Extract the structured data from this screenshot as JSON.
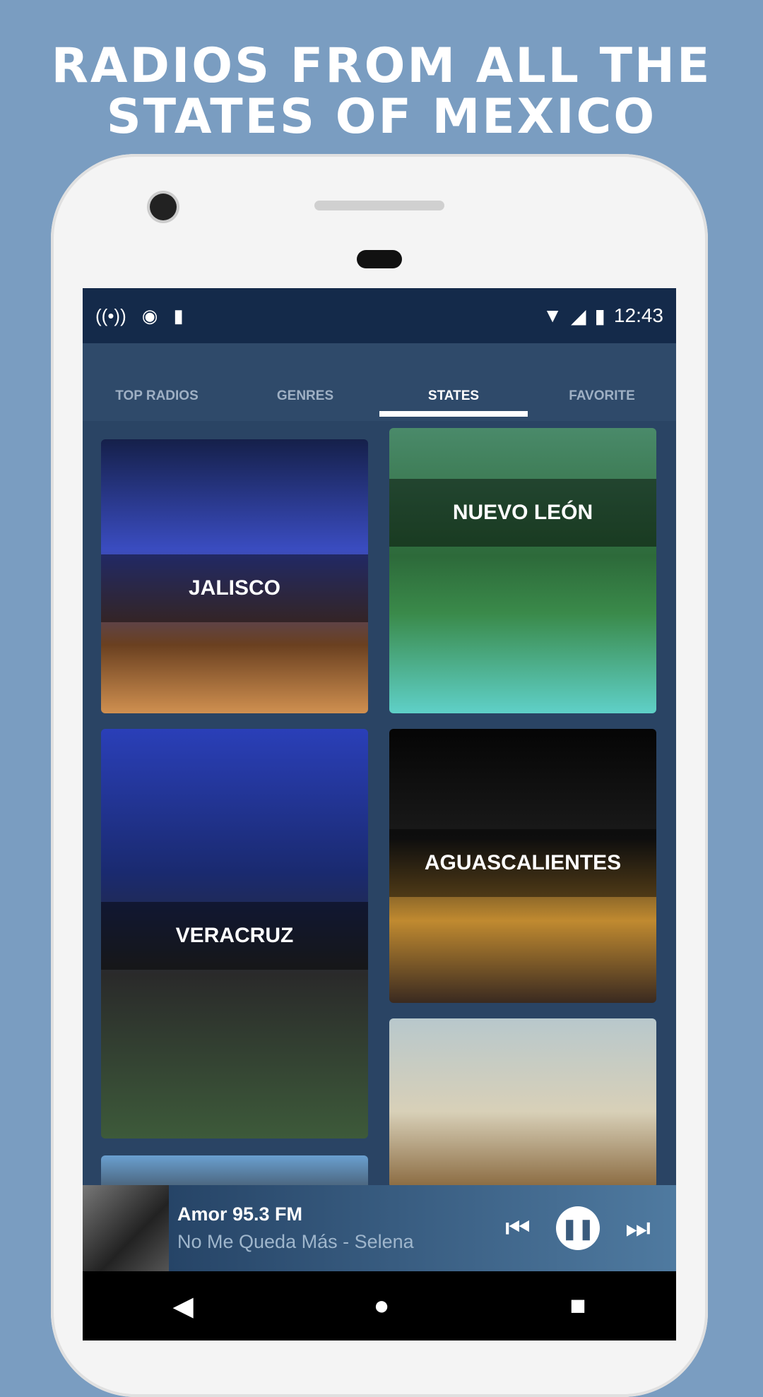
{
  "headline": {
    "line1": "RADIOS FROM ALL THE",
    "line2": "STATES OF MEXICO"
  },
  "status_bar": {
    "time": "12:43",
    "left_icons": [
      "radio-broadcast-icon",
      "circle-record-icon",
      "sd-card-icon"
    ],
    "right_icons": [
      "wifi-icon",
      "signal-icon",
      "battery-charging-icon"
    ]
  },
  "tabs": [
    {
      "label": "TOP RADIOS",
      "active": false
    },
    {
      "label": "GENRES",
      "active": false
    },
    {
      "label": "STATES",
      "active": true
    },
    {
      "label": "FAVORITE",
      "active": false
    }
  ],
  "states": [
    {
      "name": "JALISCO"
    },
    {
      "name": "NUEVO LEÓN"
    },
    {
      "name": "VERACRUZ"
    },
    {
      "name": "AGUASCALIENTES"
    },
    {
      "name": ""
    },
    {
      "name": ""
    }
  ],
  "player": {
    "station": "Amor 95.3 FM",
    "track": "No Me Queda Más - Selena",
    "icons": [
      "previous-icon",
      "pause-icon",
      "next-icon"
    ]
  },
  "nav": {
    "icons": [
      "back-icon",
      "home-icon",
      "recents-icon"
    ]
  }
}
